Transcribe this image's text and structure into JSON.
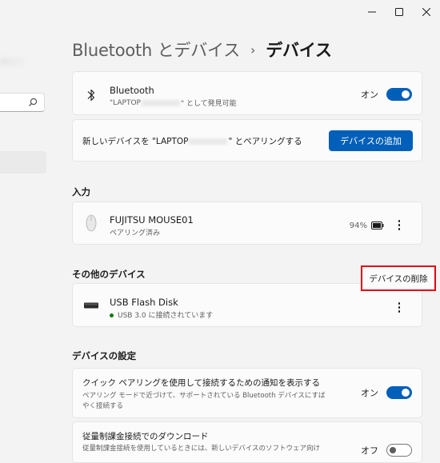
{
  "window": {
    "minimize_icon": "minimize-icon",
    "maximize_icon": "maximize-icon",
    "close_icon": "close-icon"
  },
  "header": {
    "parent": "Bluetooth とデバイス",
    "separator": "›",
    "current": "デバイス"
  },
  "bluetooth": {
    "title": "Bluetooth",
    "sub_prefix": "\"LAPTOP",
    "sub_suffix": "\" として発見可能",
    "toggle_label": "オン",
    "toggle_state": "on"
  },
  "pairing": {
    "prefix": "新しいデバイスを \"LAPTOP",
    "suffix": "\" とペアリングする",
    "add_button": "デバイスの追加"
  },
  "input_section": {
    "title": "入力",
    "device": {
      "name": "FUJITSU MOUSE01",
      "status": "ペアリング済み",
      "battery": "94%"
    }
  },
  "other_section": {
    "title": "その他のデバイス",
    "remove_button": "デバイスの削除",
    "device": {
      "name": "USB Flash Disk",
      "status": "USB 3.0 に接続されています"
    }
  },
  "settings_section": {
    "title": "デバイスの設定",
    "swift_pair": {
      "title": "クイック ペアリングを使用して接続するための通知を表示する",
      "desc_line1": "ペアリング モードで近づけて、サポートされている Bluetooth デバイスにすば",
      "desc_line2": "やく接続する",
      "toggle_label": "オン",
      "toggle_state": "on"
    },
    "metered": {
      "title": "従量制課金接続でのダウンロード",
      "desc_line1": "従量制課金接続を使用しているときには、新しいデバイスのソフトウェア向け",
      "toggle_label": "オフ",
      "toggle_state": "off"
    }
  },
  "colors": {
    "accent": "#005fb8",
    "callout": "#e60012",
    "status_ok": "#0f7b0f"
  }
}
